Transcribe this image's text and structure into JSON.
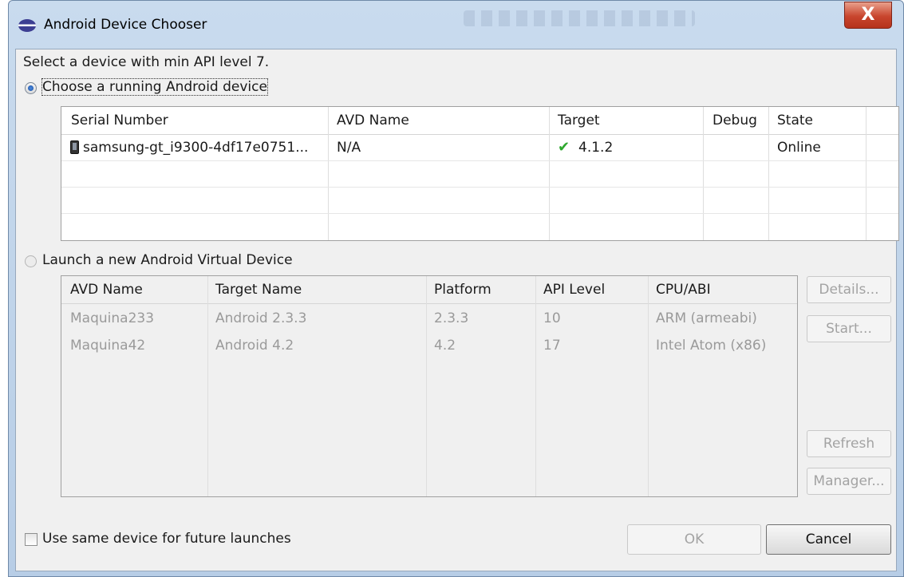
{
  "window": {
    "title": "Android Device Chooser",
    "close_label": "X"
  },
  "instruction": "Select a device with min API level 7.",
  "running": {
    "option_label": "Choose a running Android device",
    "selected": true,
    "columns": [
      "Serial Number",
      "AVD Name",
      "Target",
      "Debug",
      "State"
    ],
    "rows": [
      {
        "serial": "samsung-gt_i9300-4df17e0751...",
        "avd_name": "N/A",
        "target": "4.1.2",
        "target_icon": "check-icon",
        "debug": "",
        "state": "Online"
      }
    ]
  },
  "avd": {
    "option_label": "Launch a new Android Virtual Device",
    "selected": false,
    "columns": [
      "AVD Name",
      "Target Name",
      "Platform",
      "API Level",
      "CPU/ABI"
    ],
    "rows": [
      {
        "name": "Maquina233",
        "target": "Android 2.3.3",
        "platform": "2.3.3",
        "api": "10",
        "cpu": "ARM (armeabi)"
      },
      {
        "name": "Maquina42",
        "target": "Android 4.2",
        "platform": "4.2",
        "api": "17",
        "cpu": "Intel Atom (x86)"
      }
    ],
    "buttons": {
      "details": "Details...",
      "start": "Start...",
      "refresh": "Refresh",
      "manager": "Manager..."
    }
  },
  "footer": {
    "same_device_label": "Use same device for future launches",
    "same_device_checked": false,
    "ok": "OK",
    "cancel": "Cancel"
  },
  "colors": {
    "check": "#2ea82e",
    "close_button": "#c8452d",
    "disabled_text": "#9a9a9a"
  }
}
